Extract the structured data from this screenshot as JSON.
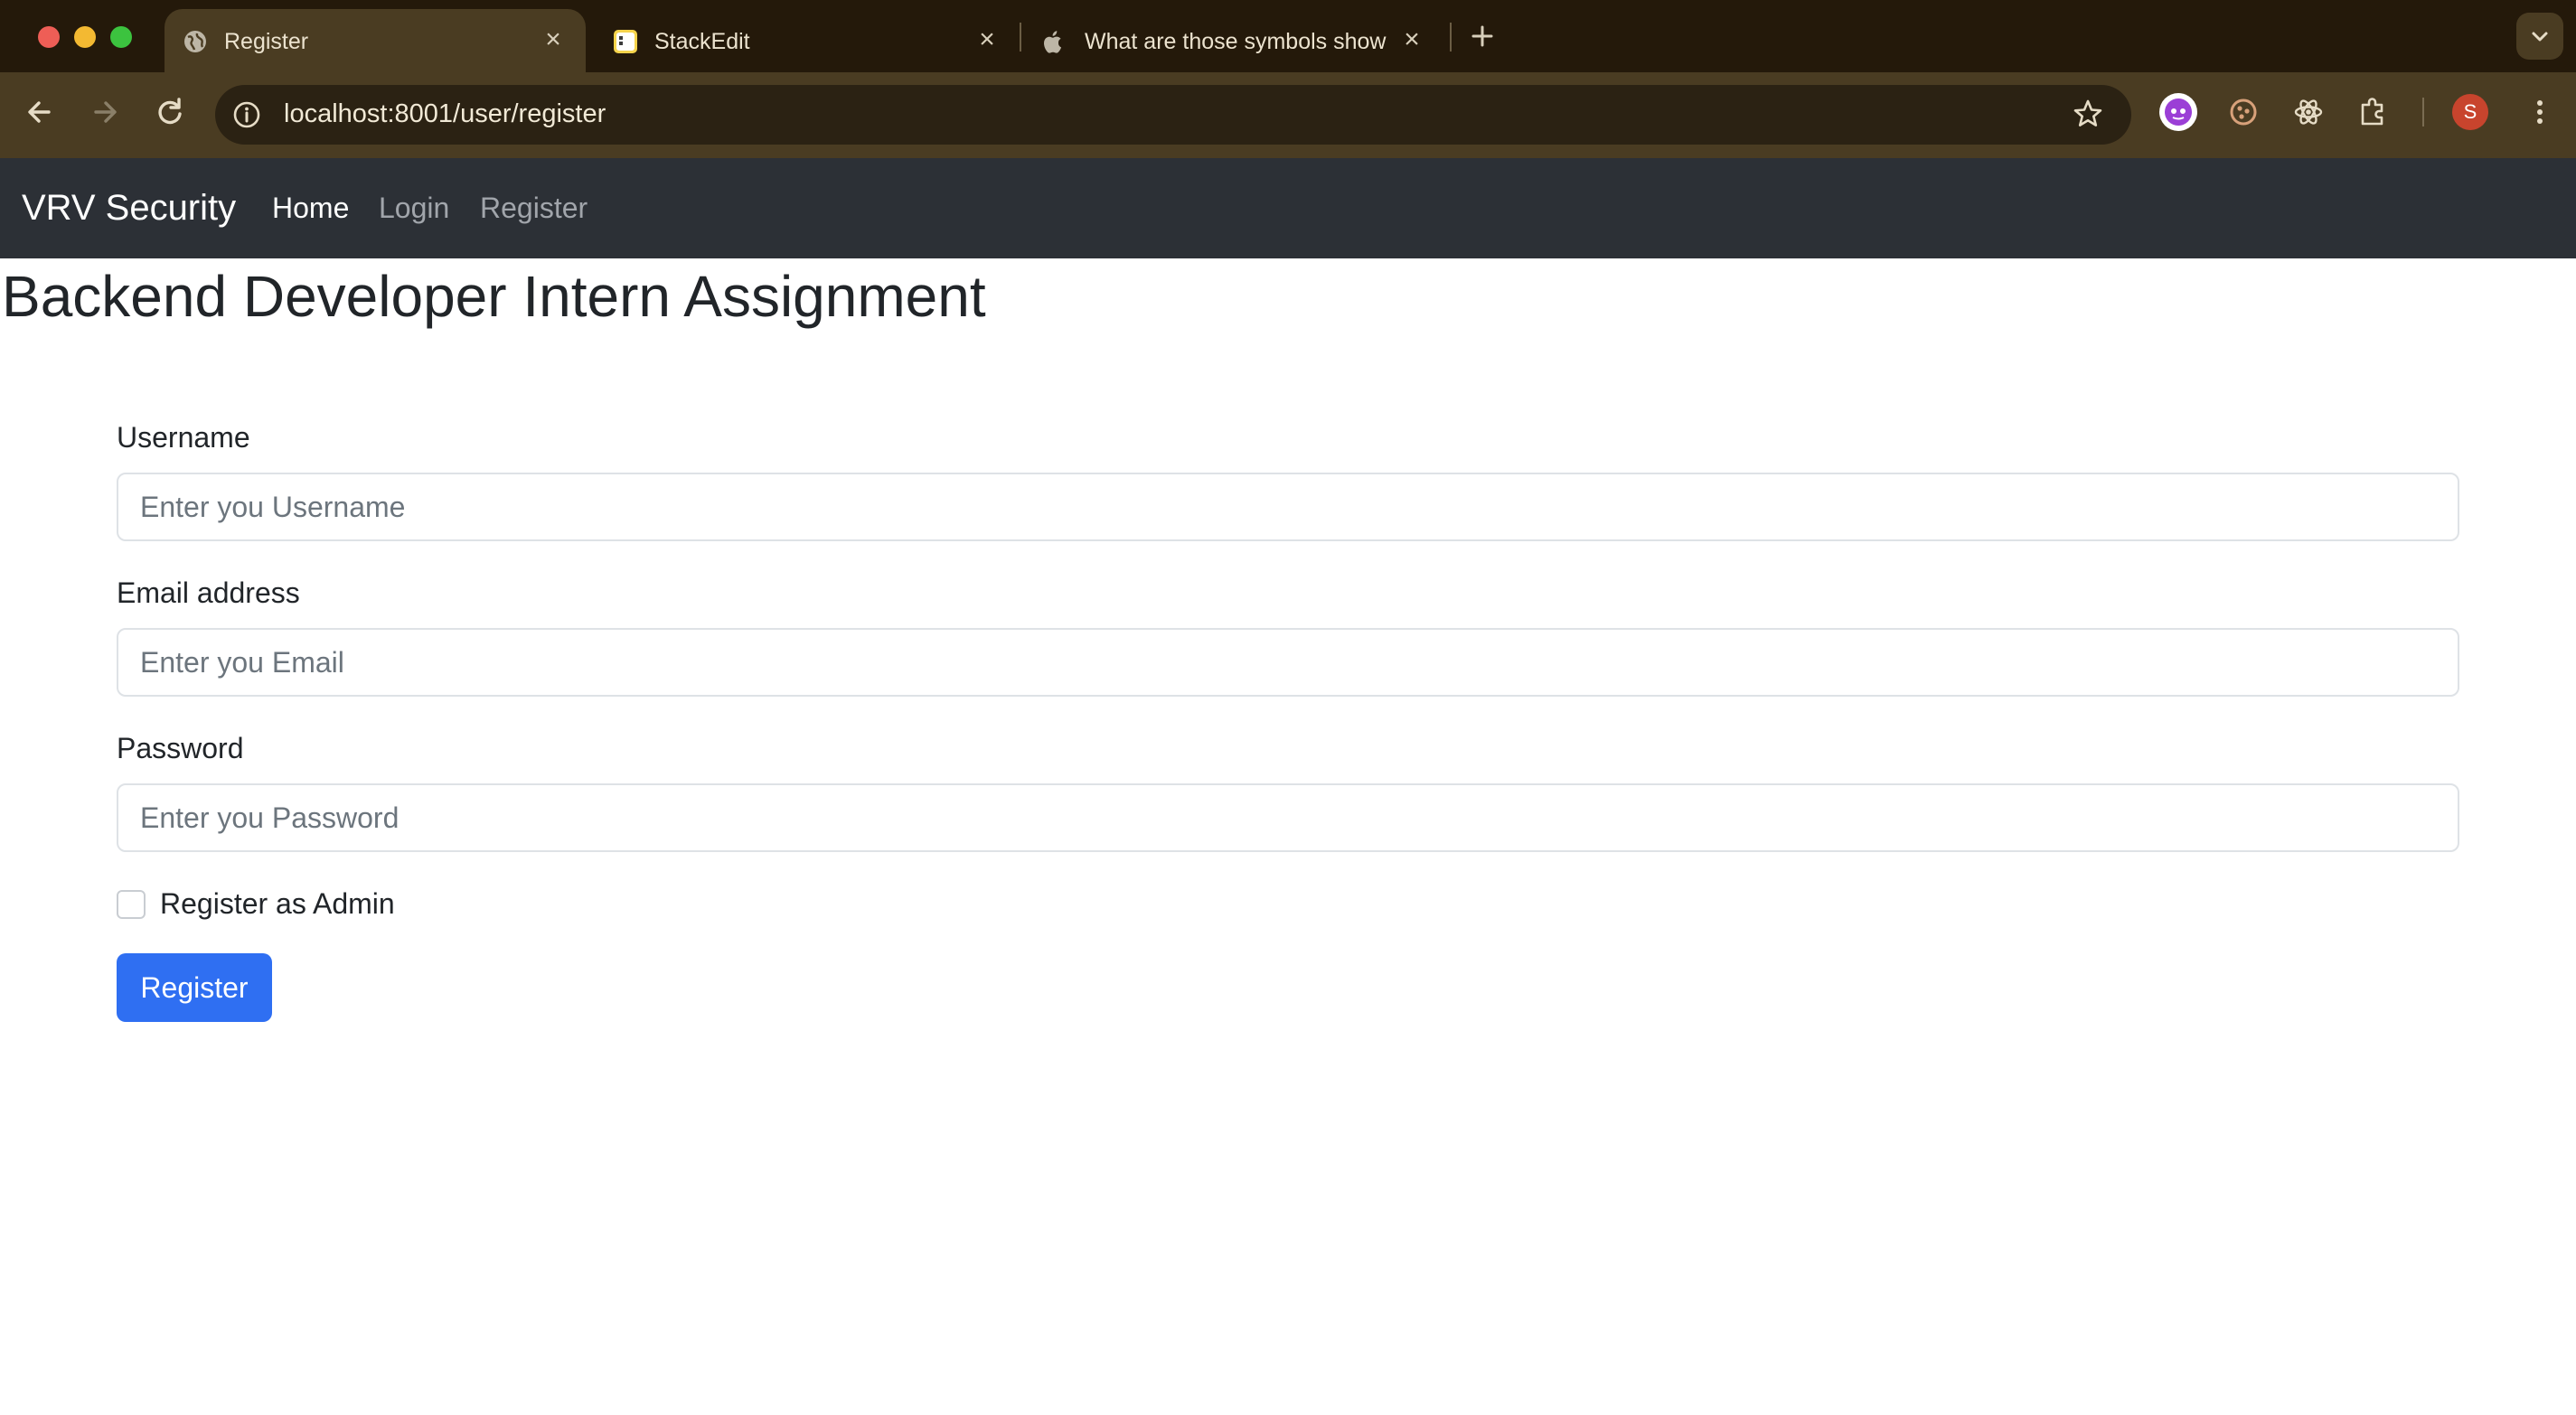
{
  "browser": {
    "tabs": [
      {
        "title": "Register",
        "favicon": "globe-icon",
        "active": true
      },
      {
        "title": "StackEdit",
        "favicon": "stackedit-icon",
        "active": false
      },
      {
        "title": "What are those symbols show",
        "favicon": "apple-icon",
        "active": false
      }
    ],
    "url": "localhost:8001/user/register",
    "profile_initial": "S"
  },
  "navbar": {
    "brand": "VRV Security",
    "links": [
      {
        "label": "Home",
        "active": true
      },
      {
        "label": "Login",
        "active": false
      },
      {
        "label": "Register",
        "active": false
      }
    ]
  },
  "page": {
    "title": "Backend Developer Intern Assignment"
  },
  "form": {
    "username": {
      "label": "Username",
      "placeholder": "Enter you Username",
      "value": ""
    },
    "email": {
      "label": "Email address",
      "placeholder": "Enter you Email",
      "value": ""
    },
    "password": {
      "label": "Password",
      "placeholder": "Enter you Password",
      "value": ""
    },
    "admin_checkbox": {
      "label": "Register as Admin",
      "checked": false
    },
    "submit_label": "Register"
  },
  "colors": {
    "navbar_bg": "#2c3036",
    "primary_button": "#2f6ff2",
    "chrome_toolbar": "#4a3c22"
  }
}
